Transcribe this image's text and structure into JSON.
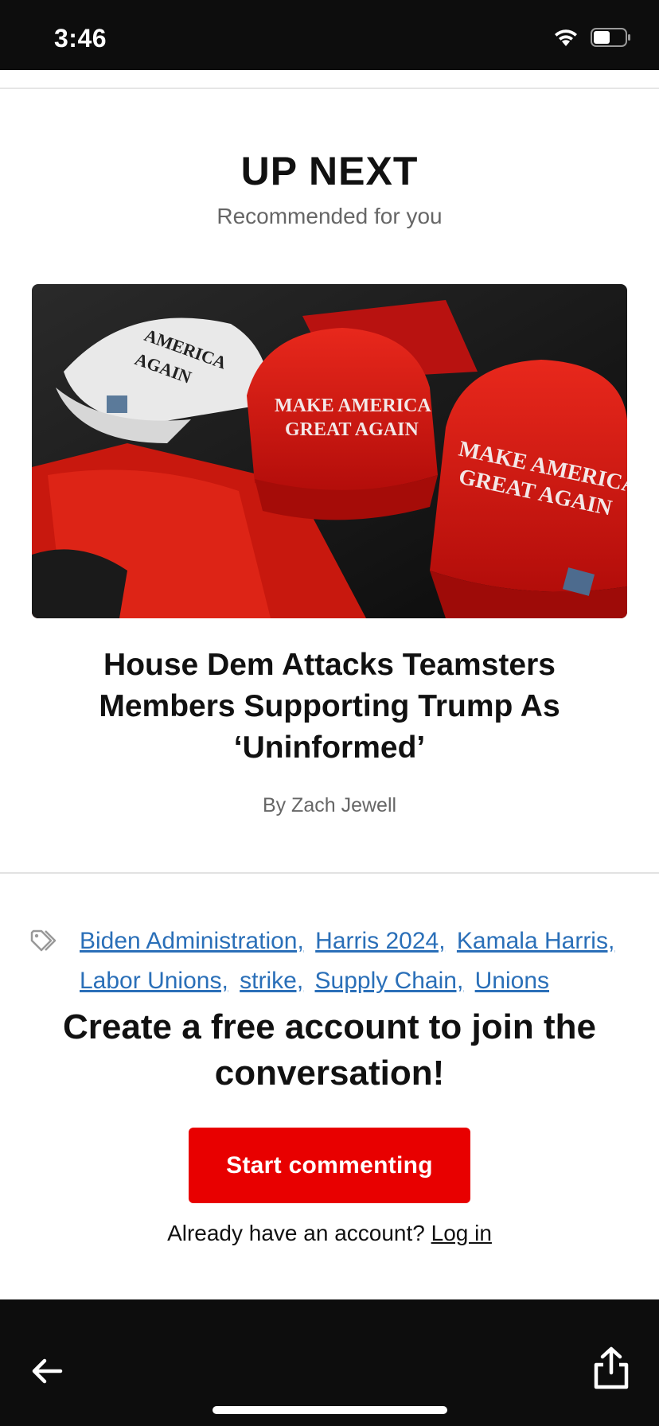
{
  "status_bar": {
    "time": "3:46",
    "icons": [
      "wifi-icon",
      "battery-icon"
    ]
  },
  "section": {
    "heading": "UP NEXT",
    "subheading": "Recommended for you"
  },
  "article": {
    "image_icon": "hero-photo",
    "title": "House Dem Attacks Teamsters Members Supporting Trump As ‘Uninformed’",
    "byline": "By Zach Jewell",
    "hat_text": [
      "MAKE AMERICA",
      "GREAT AGAIN",
      "AMERICA",
      "AGAIN"
    ]
  },
  "tags": {
    "icon": "tag-icon",
    "items": [
      "Biden Administration,",
      "Harris 2024,",
      "Kamala Harris,",
      "Labor Unions,",
      "strike,",
      "Supply Chain,",
      "Unions"
    ]
  },
  "cta": {
    "title": "Create a free account to join the conversation!",
    "button_label": "Start commenting",
    "login_prompt": "Already have an account?",
    "login_link": "Log in"
  },
  "bottom_bar": {
    "back_icon": "arrow-left-icon",
    "share_icon": "share-icon"
  },
  "colors": {
    "accent": "#e80000",
    "link": "#2a6fb8",
    "bar": "#0d0d0d"
  }
}
